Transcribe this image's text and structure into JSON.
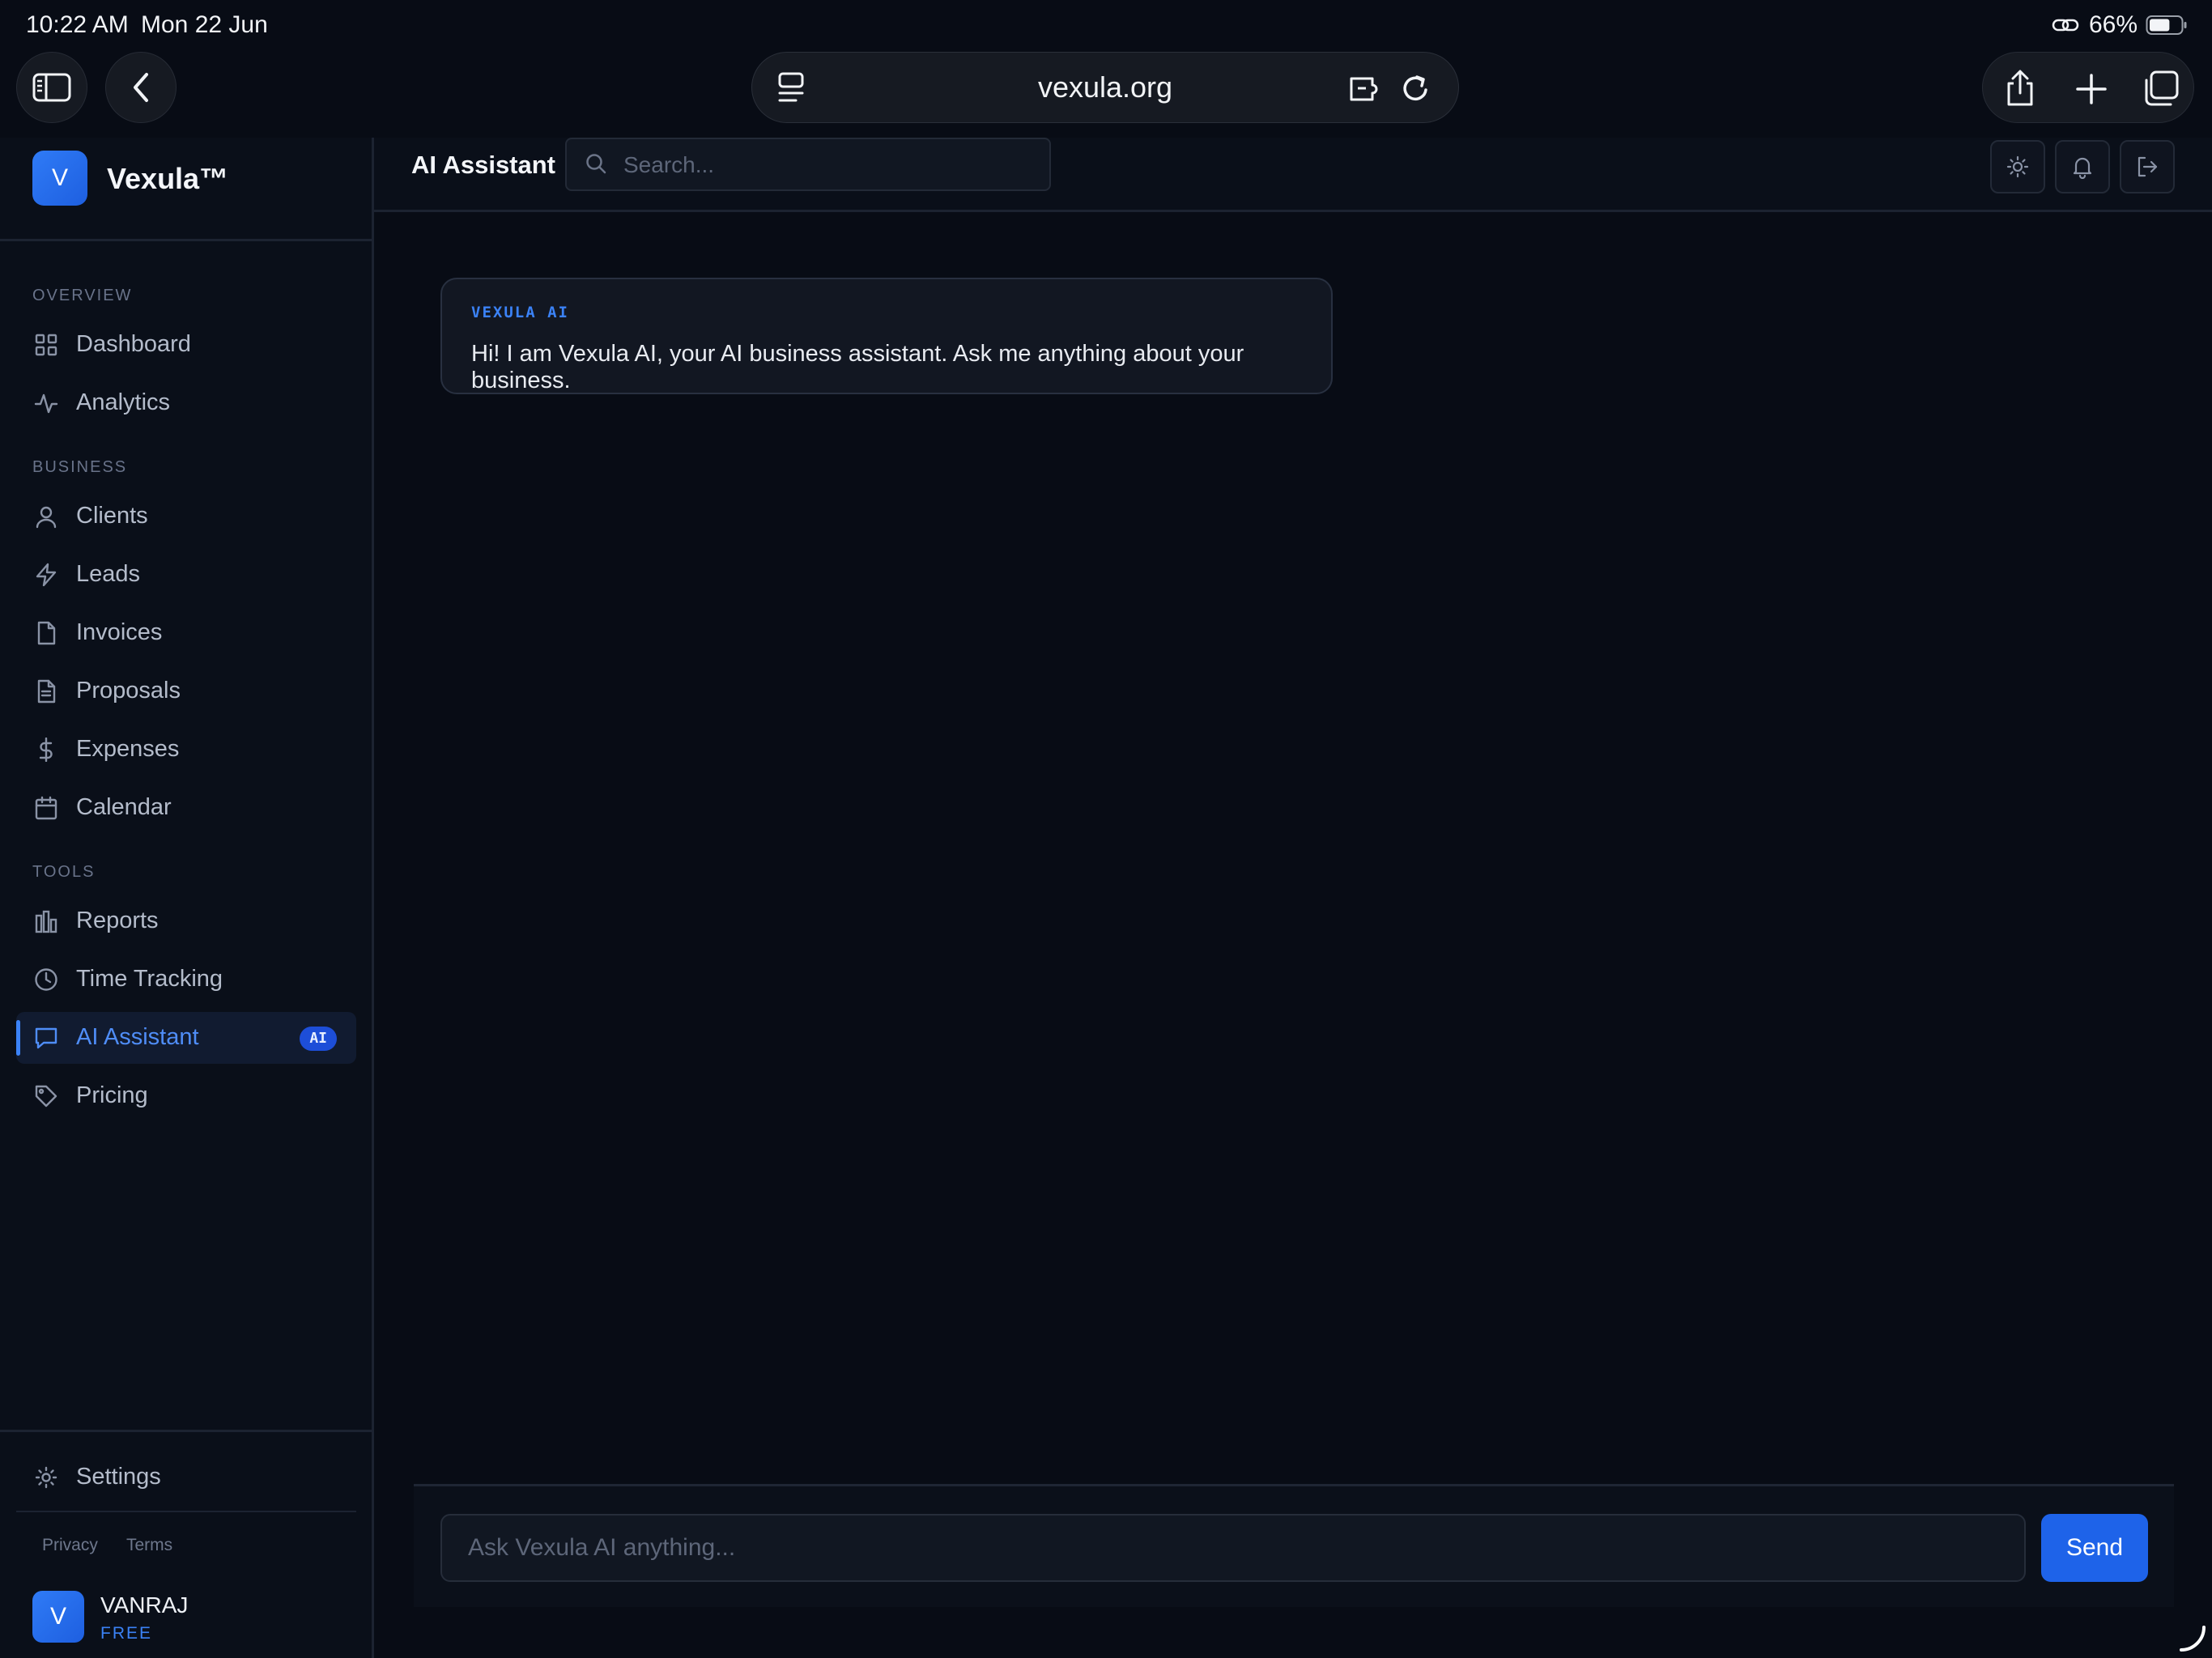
{
  "status_bar": {
    "time": "10:22 AM",
    "date": "Mon 22 Jun",
    "battery_percent": "66%",
    "battery_level": 0.66
  },
  "browser": {
    "url": "vexula.org"
  },
  "brand": {
    "logo_letter": "V",
    "name": "Vexula™"
  },
  "sidebar": {
    "sections": [
      {
        "title": "OVERVIEW"
      },
      {
        "title": "BUSINESS"
      },
      {
        "title": "TOOLS"
      }
    ],
    "items": [
      {
        "label": "Dashboard",
        "icon": "grid-icon"
      },
      {
        "label": "Analytics",
        "icon": "activity-icon"
      },
      {
        "label": "Clients",
        "icon": "user-icon"
      },
      {
        "label": "Leads",
        "icon": "lightning-icon"
      },
      {
        "label": "Invoices",
        "icon": "file-icon"
      },
      {
        "label": "Proposals",
        "icon": "file-text-icon"
      },
      {
        "label": "Expenses",
        "icon": "dollar-icon"
      },
      {
        "label": "Calendar",
        "icon": "calendar-icon"
      },
      {
        "label": "Reports",
        "icon": "bar-chart-icon"
      },
      {
        "label": "Time Tracking",
        "icon": "clock-icon"
      },
      {
        "label": "AI Assistant",
        "icon": "message-icon",
        "active": true,
        "badge": "AI"
      },
      {
        "label": "Pricing",
        "icon": "tag-icon"
      }
    ],
    "settings_label": "Settings",
    "footer_links": [
      "Privacy",
      "Terms"
    ],
    "user": {
      "avatar_letter": "V",
      "name": "VANRAJ",
      "plan": "FREE"
    }
  },
  "header": {
    "title": "AI Assistant",
    "search_placeholder": "Search...",
    "actions": [
      "sun-icon",
      "bell-icon",
      "logout-icon"
    ]
  },
  "chat": {
    "messages": [
      {
        "sender": "VEXULA AI",
        "text": "Hi! I am Vexula AI, your AI business assistant. Ask me anything about your business."
      }
    ],
    "input_placeholder": "Ask Vexula AI anything...",
    "send_label": "Send"
  },
  "colors": {
    "background": "#080c15",
    "sidebar": "#0a0f19",
    "accent": "#3b82f6",
    "send_button": "#1e63e9"
  }
}
